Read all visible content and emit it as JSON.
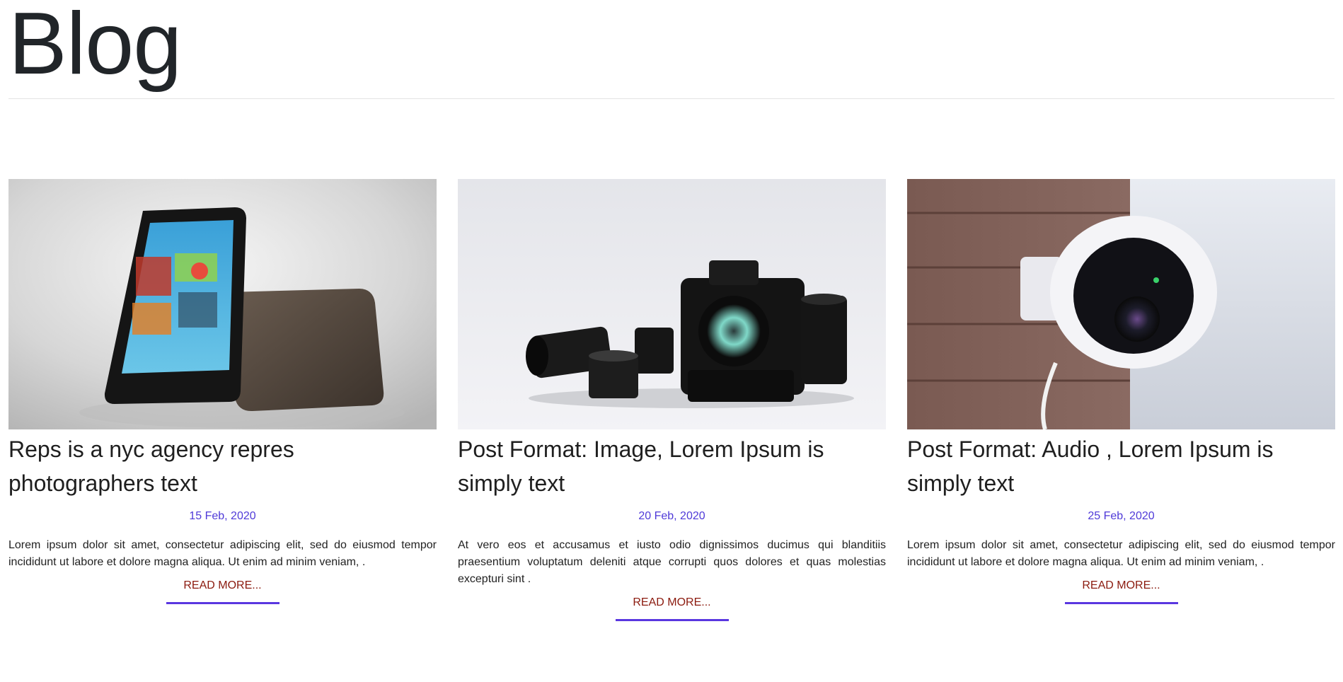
{
  "page": {
    "title": "Blog"
  },
  "colors": {
    "date": "#4f3ad8",
    "read_more_text": "#8b1a0e",
    "read_more_underline": "#5a37e0"
  },
  "posts": [
    {
      "image": "tablet-photo",
      "title": "Reps is a nyc agency repres photographers text",
      "date": "15 Feb, 2020",
      "excerpt": "Lorem ipsum dolor sit amet, consectetur adipiscing elit, sed do eiusmod tempor incididunt ut labore et dolore magna aliqua. Ut enim ad minim veniam, .",
      "read_more": "READ MORE..."
    },
    {
      "image": "camera-photo",
      "title": "Post Format: Image, Lorem Ipsum is simply text",
      "date": "20 Feb, 2020",
      "excerpt": "At vero eos et accusamus et iusto odio dignissimos ducimus qui blanditiis praesentium voluptatum deleniti atque corrupti quos dolores et quas molestias excepturi sint .",
      "read_more": "READ MORE..."
    },
    {
      "image": "security-camera-photo",
      "title": "Post Format: Audio , Lorem Ipsum is simply text",
      "date": "25 Feb, 2020",
      "excerpt": "Lorem ipsum dolor sit amet, consectetur adipiscing elit, sed do eiusmod tempor incididunt ut labore et dolore magna aliqua. Ut enim ad minim veniam, .",
      "read_more": "READ MORE..."
    }
  ]
}
